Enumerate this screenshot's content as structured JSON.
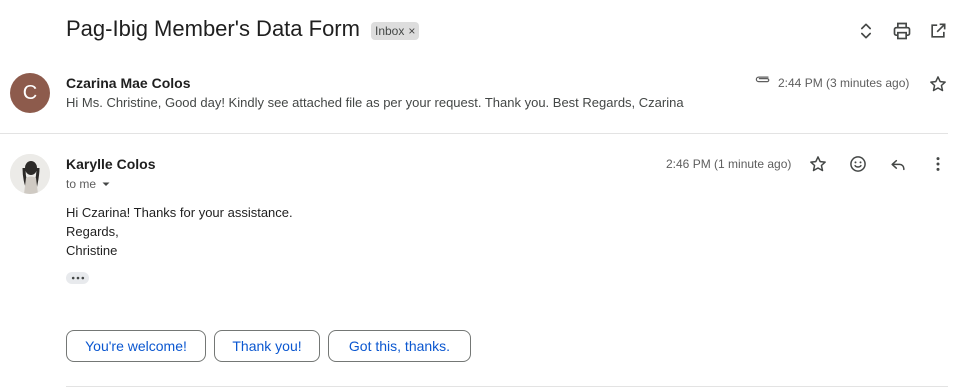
{
  "subject": "Pag-Ibig Member's Data Form",
  "label_chip": {
    "text": "Inbox",
    "remove": "×"
  },
  "toolbar": {
    "icons": [
      "expand-collapse-icon",
      "print-icon",
      "open-in-new-window-icon"
    ]
  },
  "messages": [
    {
      "avatar_letter": "C",
      "avatar_color": "#8d5b4c",
      "sender": "Czarina Mae Colos",
      "time": "2:44 PM (3 minutes ago)",
      "snippet": "Hi Ms. Christine, Good day! Kindly see attached file as per your request. Thank you. Best Regards, Czarina",
      "has_attachment": true
    },
    {
      "sender": "Karylle Colos",
      "time": "2:46 PM (1 minute ago)",
      "recipient": "to me",
      "body": [
        "Hi Czarina! Thanks for your assistance.",
        "Regards,",
        "Christine"
      ]
    }
  ],
  "smart_replies": [
    "You're welcome!",
    "Thank you!",
    "Got this, thanks."
  ],
  "colors": {
    "accent": "#0b57d0",
    "text": "#1f1f1f",
    "muted": "#444746"
  }
}
